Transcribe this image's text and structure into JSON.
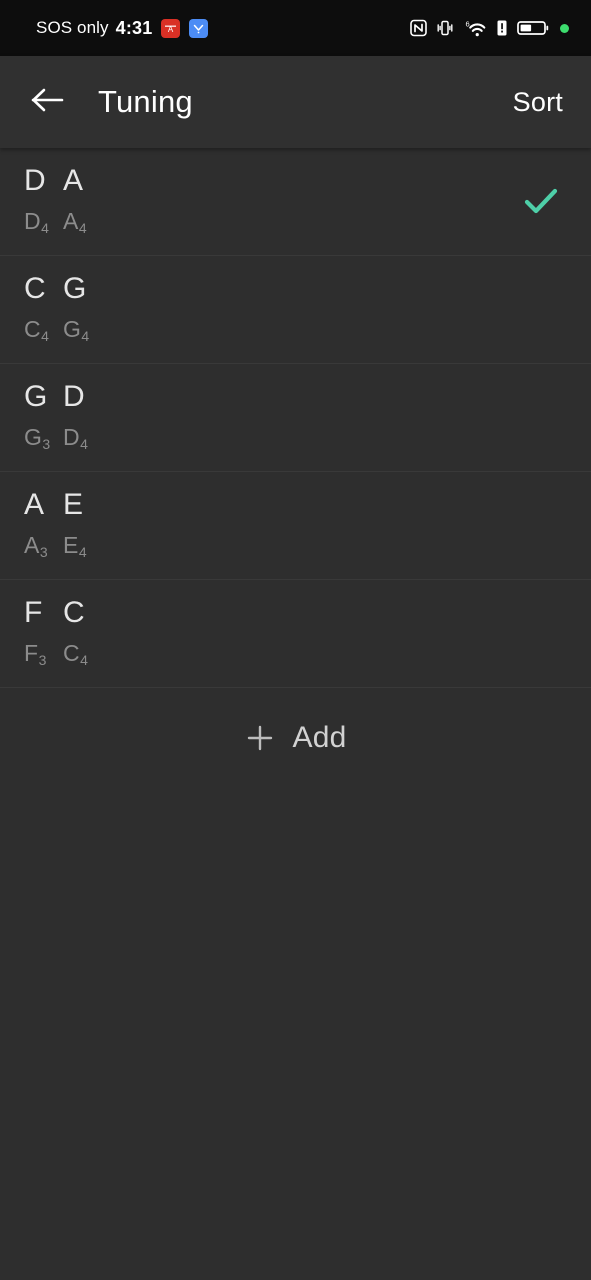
{
  "status_bar": {
    "carrier": "SOS only",
    "time": "4:31",
    "notifications": [
      {
        "name": "notification-badge-red",
        "color": "#d93025"
      },
      {
        "name": "notification-badge-blue",
        "color": "#4c8cf5"
      }
    ],
    "icons": [
      "nfc-icon",
      "vibrate-icon",
      "wifi-6-icon",
      "alert-icon",
      "battery-icon",
      "privacy-indicator-dot"
    ],
    "wifi_generation": "6",
    "battery_level_percent": 45,
    "privacy_dot_color": "#3ddc6e"
  },
  "app_bar": {
    "back_icon": "arrow-left-icon",
    "title": "Tuning",
    "sort_label": "Sort"
  },
  "list": {
    "selected_index": 0,
    "check_color": "#4ecfa8",
    "items": [
      {
        "notes": [
          "D",
          "A"
        ],
        "pitches": [
          {
            "note": "D",
            "octave": "4"
          },
          {
            "note": "A",
            "octave": "4"
          }
        ],
        "selected": true
      },
      {
        "notes": [
          "C",
          "G"
        ],
        "pitches": [
          {
            "note": "C",
            "octave": "4"
          },
          {
            "note": "G",
            "octave": "4"
          }
        ],
        "selected": false
      },
      {
        "notes": [
          "G",
          "D"
        ],
        "pitches": [
          {
            "note": "G",
            "octave": "3"
          },
          {
            "note": "D",
            "octave": "4"
          }
        ],
        "selected": false
      },
      {
        "notes": [
          "A",
          "E"
        ],
        "pitches": [
          {
            "note": "A",
            "octave": "3"
          },
          {
            "note": "E",
            "octave": "4"
          }
        ],
        "selected": false
      },
      {
        "notes": [
          "F",
          "C"
        ],
        "pitches": [
          {
            "note": "F",
            "octave": "3"
          },
          {
            "note": "C",
            "octave": "4"
          }
        ],
        "selected": false
      }
    ]
  },
  "add": {
    "icon": "plus-icon",
    "label": "Add"
  },
  "theme": {
    "status_bar_bg": "#0d0d0d",
    "app_bar_bg": "#303030",
    "list_bg": "#2e2e2e",
    "divider": "#393939",
    "primary_text": "#e6e6e6",
    "secondary_text": "#8c8c8c",
    "accent": "#4ecfa8"
  }
}
